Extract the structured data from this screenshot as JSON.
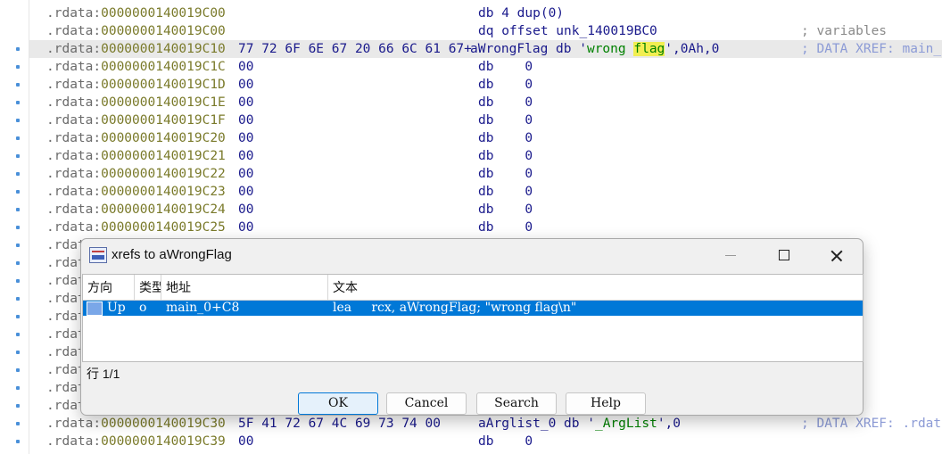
{
  "listing": {
    "lines": [
      {
        "seg": ".rdata:",
        "addr": "0000000140019C00",
        "bytes": "",
        "ins": "db 4 dup(0)",
        "comment": ""
      },
      {
        "seg": ".rdata:",
        "addr": "0000000140019C00",
        "bytes": "",
        "ins": "dq offset unk_140019BC0",
        "comment": "; variables"
      },
      {
        "seg": ".rdata:",
        "addr": "0000000140019C10",
        "bytes": "77 72 6F 6E 67 20 66 6C 61 67+",
        "label": "aWrongFlag",
        "ins_pre": " db '",
        "str_a": "wrong ",
        "str_hl": "flag",
        "ins_post": "',0Ah,0",
        "comment": "; DATA XREF: main_"
      },
      {
        "seg": ".rdata:",
        "addr": "0000000140019C1C",
        "bytes": "00",
        "ins": "db    0",
        "comment": ""
      },
      {
        "seg": ".rdata:",
        "addr": "0000000140019C1D",
        "bytes": "00",
        "ins": "db    0",
        "comment": ""
      },
      {
        "seg": ".rdata:",
        "addr": "0000000140019C1E",
        "bytes": "00",
        "ins": "db    0",
        "comment": ""
      },
      {
        "seg": ".rdata:",
        "addr": "0000000140019C1F",
        "bytes": "00",
        "ins": "db    0",
        "comment": ""
      },
      {
        "seg": ".rdata:",
        "addr": "0000000140019C20",
        "bytes": "00",
        "ins": "db    0",
        "comment": ""
      },
      {
        "seg": ".rdata:",
        "addr": "0000000140019C21",
        "bytes": "00",
        "ins": "db    0",
        "comment": ""
      },
      {
        "seg": ".rdata:",
        "addr": "0000000140019C22",
        "bytes": "00",
        "ins": "db    0",
        "comment": ""
      },
      {
        "seg": ".rdata:",
        "addr": "0000000140019C23",
        "bytes": "00",
        "ins": "db    0",
        "comment": ""
      },
      {
        "seg": ".rdata:",
        "addr": "0000000140019C24",
        "bytes": "00",
        "ins": "db    0",
        "comment": ""
      },
      {
        "seg": ".rdata:",
        "addr": "0000000140019C25",
        "bytes": "00",
        "ins": "db    0",
        "comment": ""
      },
      {
        "seg": ".rdat",
        "addr": "",
        "bytes": "",
        "ins": "",
        "comment": ""
      },
      {
        "seg": ".rdat",
        "addr": "",
        "bytes": "",
        "ins": "",
        "comment": ""
      },
      {
        "seg": ".rdat",
        "addr": "",
        "bytes": "",
        "ins": "",
        "comment": ""
      },
      {
        "seg": ".rdat",
        "addr": "",
        "bytes": "",
        "ins": "",
        "comment": ""
      },
      {
        "seg": ".rdat",
        "addr": "",
        "bytes": "",
        "ins": "",
        "comment": ""
      },
      {
        "seg": ".rdat",
        "addr": "",
        "bytes": "",
        "ins": "",
        "comment": ""
      },
      {
        "seg": ".rdat",
        "addr": "",
        "bytes": "",
        "ins": "",
        "comment": ""
      },
      {
        "seg": ".rdat",
        "addr": "",
        "bytes": "",
        "ins": "",
        "comment": ""
      },
      {
        "seg": ".rdat",
        "addr": "",
        "bytes": "",
        "ins": "",
        "comment": ""
      },
      {
        "seg": ".rdat",
        "addr": "",
        "bytes": "",
        "ins": "",
        "comment": ""
      },
      {
        "seg": ".rdata:",
        "addr": "0000000140019C30",
        "bytes": "5F 41 72 67 4C 69 73 74 00",
        "label": "aArglist_0",
        "ins_pre": " db '",
        "str_a": "_ArgList",
        "str_hl": "",
        "ins_post": "',0",
        "comment": "; DATA XREF: .rdat"
      },
      {
        "seg": ".rdata:",
        "addr": "0000000140019C39",
        "bytes": "00",
        "ins": "db    0",
        "comment": ""
      }
    ]
  },
  "dialog": {
    "title": "xrefs to aWrongFlag",
    "columns": [
      "方向",
      "类型",
      "地址",
      "文本"
    ],
    "rows": [
      {
        "direction": "Up",
        "type": "o",
        "address": "main_0+C8",
        "text": "lea     rcx, aWrongFlag; \"wrong flag\\n\""
      }
    ],
    "status": "行 1/1",
    "buttons": {
      "ok": "OK",
      "cancel": "Cancel",
      "search": "Search",
      "help": "Help"
    }
  },
  "colors": {
    "selection": "#0078d7",
    "highlight": "#f2ee52",
    "address": "#7a7a2a",
    "code": "#1a1a8c",
    "string": "#008000"
  }
}
